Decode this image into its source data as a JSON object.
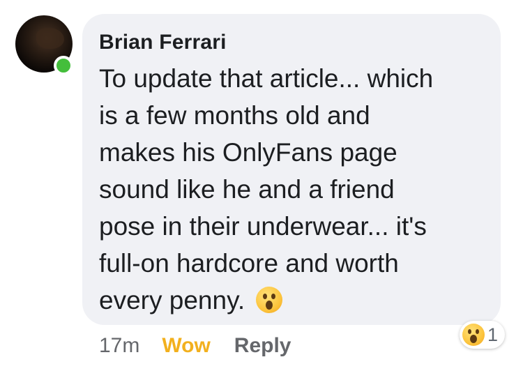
{
  "comment": {
    "author": "Brian Ferrari",
    "text": "To update that article... which\nis a few months old and\nmakes his OnlyFans page\nsound like he and a friend\npose in their underwear... it's\nfull-on hardcore and worth\nevery penny.",
    "inline_emoji": "wow-emoji-icon"
  },
  "reactions": {
    "icon": "wow-emoji-icon",
    "count": "1"
  },
  "meta": {
    "timestamp": "17m",
    "reaction_label": "Wow",
    "reply_label": "Reply"
  },
  "colors": {
    "bubble": "#f0f1f5",
    "online": "#44be3b",
    "wow": "#f2b01e",
    "muted": "#65676b"
  }
}
